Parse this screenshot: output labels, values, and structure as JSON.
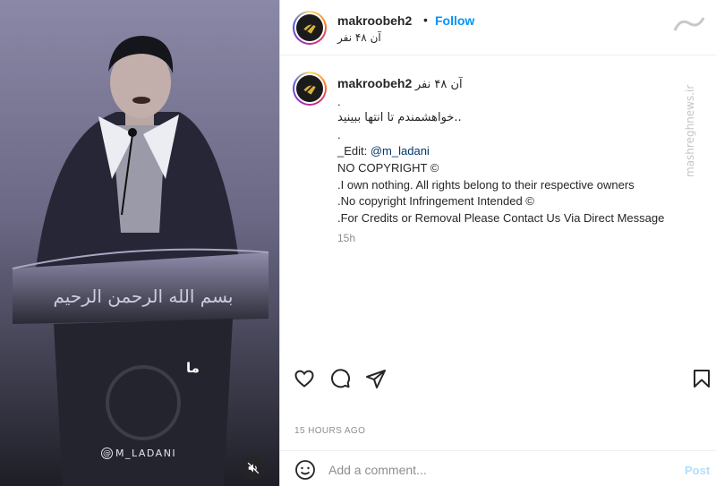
{
  "post": {
    "username": "makroobeh2",
    "follow_label": "Follow",
    "separator": "•",
    "header_subtitle": "آن ۴۸ نفر",
    "caption": {
      "username": "makroobeh2",
      "heading": "آن ۴۸ نفر",
      "lines": [
        ".",
        "خواهشمندم تا انتها ببینید..",
        ".",
        "_Edit: ",
        "NO COPYRIGHT ©",
        ".I own nothing. All rights belong to their respective owners",
        ".No copyright Infringement Intended ©",
        ".For Credits or Removal Please Contact Us Via Direct Message"
      ],
      "mention": "@m_ladani",
      "age": "15h"
    },
    "timestamp": "15 HOURS AGO",
    "comment_placeholder": "Add a comment...",
    "post_label": "Post"
  },
  "media": {
    "overlay_text": "ما",
    "credit_text": "M_LADANI",
    "credit_prefix": "@",
    "lectern_inscription": "بسم الله الرحمن الرحیم"
  },
  "icons": {
    "like": "heart-icon",
    "comment": "comment-icon",
    "share": "paper-plane-icon",
    "save": "bookmark-icon",
    "emoji": "smiley-icon",
    "mute": "speaker-muted-icon"
  },
  "site_watermark": "mashreghnews.ir",
  "colors": {
    "follow": "#0095f6",
    "post_disabled": "#b2dffc",
    "mention": "#00376b",
    "muted_text": "#8e8e8e"
  }
}
